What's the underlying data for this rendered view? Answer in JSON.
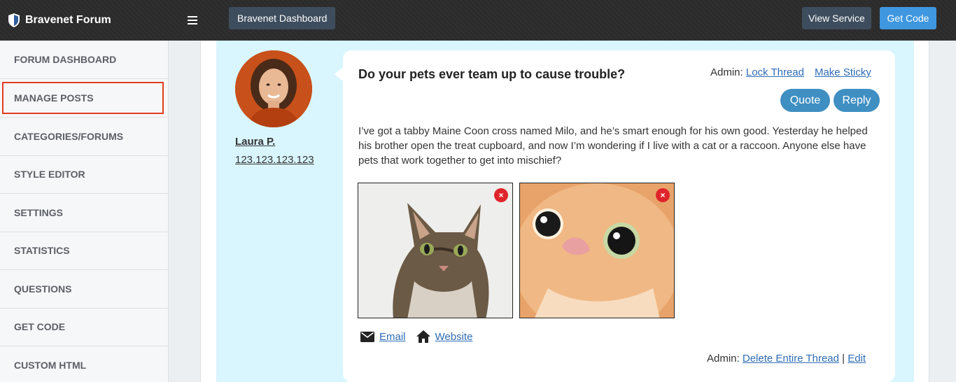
{
  "topbar": {
    "brand": "Bravenet Forum",
    "menu_icon": "hamburger-icon",
    "dashboard_label": "Bravenet Dashboard",
    "view_service_label": "View Service",
    "get_code_label": "Get Code"
  },
  "sidebar": {
    "items": [
      {
        "label": "FORUM DASHBOARD",
        "active": false
      },
      {
        "label": "MANAGE POSTS",
        "active": true
      },
      {
        "label": "CATEGORIES/FORUMS",
        "active": false
      },
      {
        "label": "STYLE EDITOR",
        "active": false
      },
      {
        "label": "SETTINGS",
        "active": false
      },
      {
        "label": "STATISTICS",
        "active": false
      },
      {
        "label": "QUESTIONS",
        "active": false
      },
      {
        "label": "GET CODE",
        "active": false
      },
      {
        "label": "CUSTOM HTML",
        "active": false
      }
    ]
  },
  "post": {
    "author": "Laura P.",
    "ip": "123.123.123.123",
    "title": "Do your pets ever team up to cause trouble?",
    "admin_label": "Admin:",
    "lock_thread": "Lock Thread",
    "make_sticky": "Make Sticky",
    "quote": "Quote",
    "reply": "Reply",
    "body": "I’ve got a tabby Maine Coon cross named Milo, and he’s smart enough for his own good. Yesterday he helped his brother open the treat cupboard, and now I’m wondering if I live with a cat or a raccoon. Anyone else have pets that work together to get into mischief?",
    "remove_glyph": "×",
    "email": "Email",
    "website": "Website",
    "admin_bottom_label": "Admin:",
    "delete_thread": "Delete Entire Thread",
    "separator": "|",
    "edit": "Edit"
  },
  "colors": {
    "topbar": "#2b2b2b",
    "accent": "#3f97e0",
    "post_bg": "#d9f6fe",
    "pill_button": "#3f8fc2",
    "highlight": "#e03c1f",
    "remove": "#e0242b"
  }
}
